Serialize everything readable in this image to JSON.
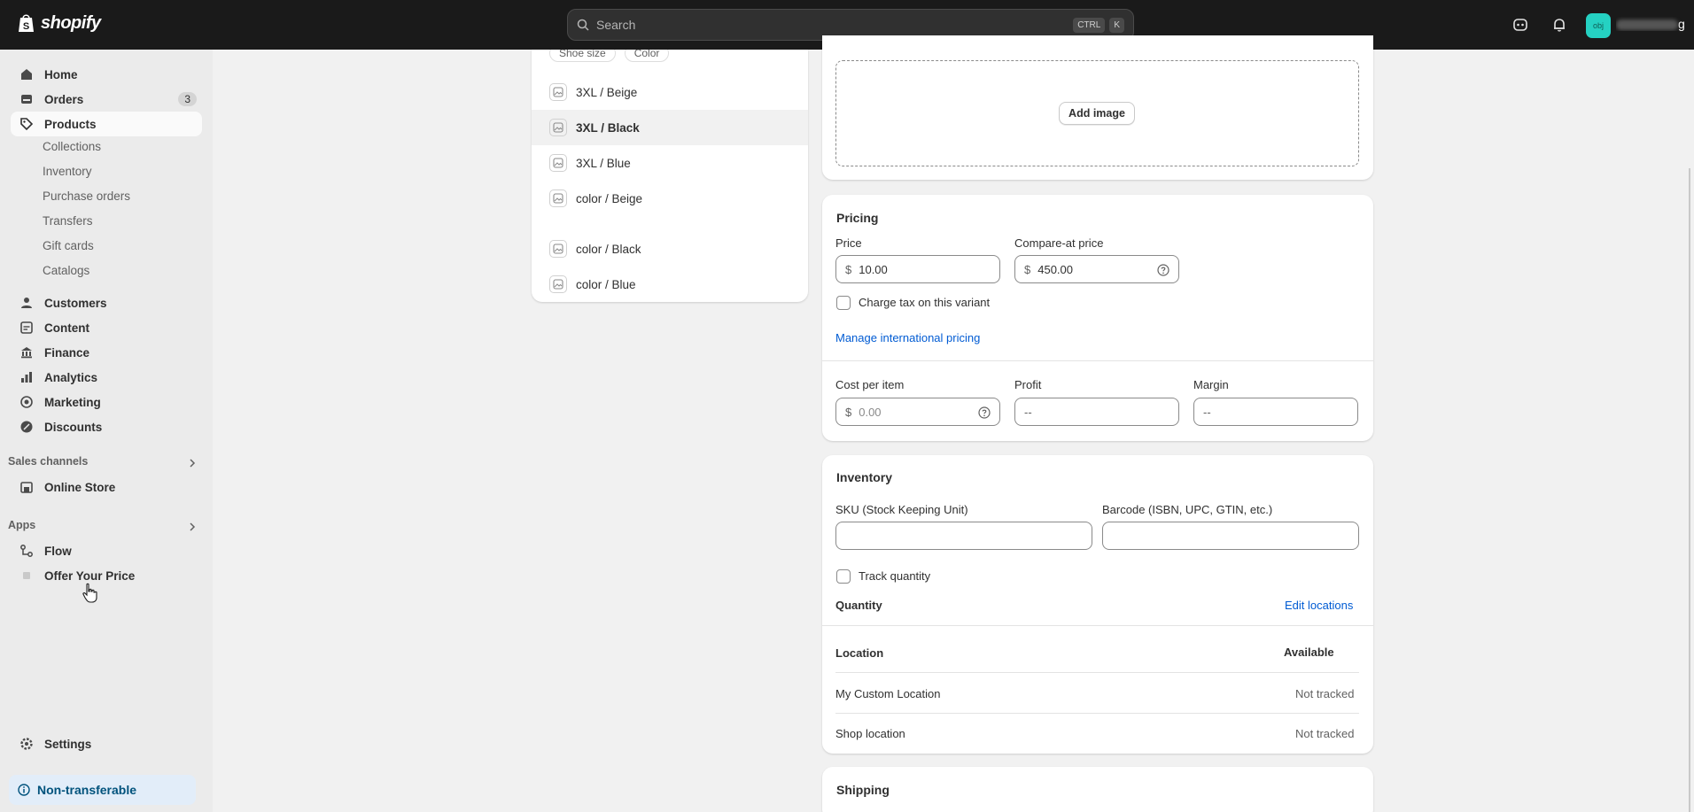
{
  "topbar": {
    "logo_text": "shopify",
    "search_placeholder": "Search",
    "kbd_ctrl": "CTRL",
    "kbd_k": "K",
    "avatar_initials": "obj",
    "store_name_suffix": "g"
  },
  "sidebar": {
    "home": "Home",
    "orders": "Orders",
    "orders_badge": "3",
    "products": "Products",
    "sub_items": [
      "Collections",
      "Inventory",
      "Purchase orders",
      "Transfers",
      "Gift cards",
      "Catalogs"
    ],
    "customers": "Customers",
    "content": "Content",
    "finance": "Finance",
    "analytics": "Analytics",
    "marketing": "Marketing",
    "discounts": "Discounts",
    "sales_channels_label": "Sales channels",
    "online_store": "Online Store",
    "apps_label": "Apps",
    "flow": "Flow",
    "offer_your_price": "Offer Your Price",
    "settings": "Settings",
    "non_transferable": "Non-transferable"
  },
  "variants": {
    "filters": [
      "Shoe size",
      "Color"
    ],
    "rows": [
      "3XL / Beige",
      "3XL / Black",
      "3XL / Blue",
      "color / Beige",
      "color / Black",
      "color / Blue"
    ],
    "selected_index": 1
  },
  "media": {
    "add_image": "Add image"
  },
  "pricing": {
    "title": "Pricing",
    "price_label": "Price",
    "price_value": "10.00",
    "compare_label": "Compare-at price",
    "compare_value": "450.00",
    "currency": "$",
    "charge_tax": "Charge tax on this variant",
    "manage_intl": "Manage international pricing",
    "cost_label": "Cost per item",
    "cost_placeholder": "0.00",
    "profit_label": "Profit",
    "profit_value": "--",
    "margin_label": "Margin",
    "margin_value": "--"
  },
  "inventory": {
    "title": "Inventory",
    "sku_label": "SKU (Stock Keeping Unit)",
    "barcode_label": "Barcode (ISBN, UPC, GTIN, etc.)",
    "track_quantity": "Track quantity",
    "quantity_label": "Quantity",
    "edit_locations": "Edit locations",
    "col_location": "Location",
    "col_available": "Available",
    "locations": [
      {
        "name": "My Custom Location",
        "available": "Not tracked"
      },
      {
        "name": "Shop location",
        "available": "Not tracked"
      }
    ]
  },
  "shipping": {
    "title": "Shipping"
  },
  "colors": {
    "topbar_bg": "#1a1a1a",
    "sidebar_bg": "#ebebeb",
    "link": "#005bd3",
    "avatar": "#25d1c2"
  }
}
